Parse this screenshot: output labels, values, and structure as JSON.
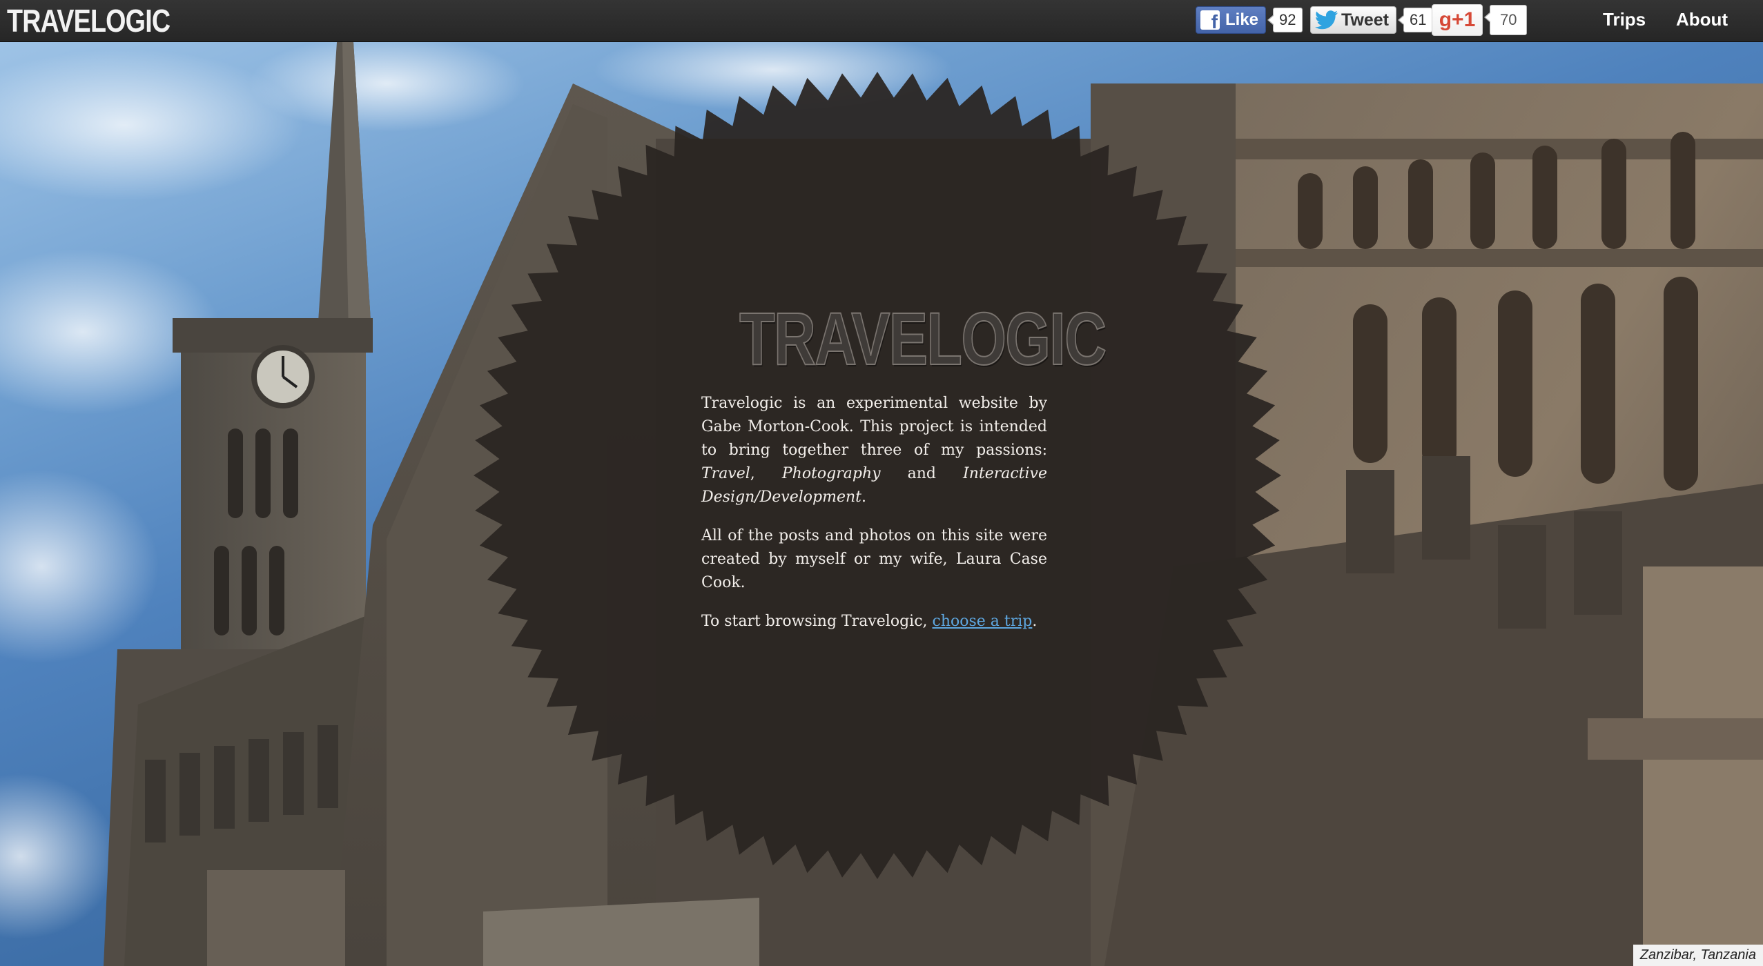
{
  "header": {
    "brand": "TRAVELOGIC",
    "facebook": {
      "label": "Like",
      "count": "92",
      "icon": "facebook-icon"
    },
    "twitter": {
      "label": "Tweet",
      "count": "61",
      "icon": "twitter-bird-icon"
    },
    "gplus": {
      "label": "g+1",
      "count": "70"
    },
    "nav": [
      "Trips",
      "About"
    ]
  },
  "intro": {
    "title": "TRAVELOGIC",
    "p1_text": "Travelogic is an experimental website by Gabe Morton-Cook. This project is intended to bring together three of my passions: ",
    "p1_em1": "Travel",
    "p1_sep1": ", ",
    "p1_em2": "Photography",
    "p1_sep2": " and ",
    "p1_em3": "Interactive Design/Development",
    "p1_end": ".",
    "p2": "All of the posts and photos on this site were created by myself or my wife, Laura Case Cook.",
    "p3_text": "To start browsing Travelogic, ",
    "p3_link": "choose a trip",
    "p3_end": "."
  },
  "photo": {
    "caption": "Zanzibar, Tanzania"
  },
  "colors": {
    "topbar": "#2b2b2b",
    "link": "#5ea7e0",
    "seal": "#2a2522",
    "sky": "#4f82bd",
    "stone": "#6e6253"
  }
}
